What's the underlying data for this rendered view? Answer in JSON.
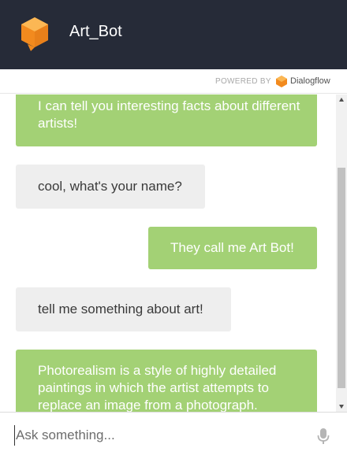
{
  "header": {
    "title": "Art_Bot",
    "logo_color": "#f28a1e",
    "background": "#262b38"
  },
  "powered_by": {
    "label": "POWERED BY",
    "brand": "Dialogflow"
  },
  "messages": [
    {
      "sender": "bot",
      "text": "I can tell you interesting facts about different artists!"
    },
    {
      "sender": "user",
      "text": "cool, what's your name?"
    },
    {
      "sender": "bot",
      "text": "They call me Art Bot!"
    },
    {
      "sender": "user",
      "text": "tell me something about art!"
    },
    {
      "sender": "bot",
      "text": "Photorealism is a style of highly detailed paintings in which the artist attempts to replace an image from a photograph."
    }
  ],
  "colors": {
    "bot_bubble": "#a3d175",
    "user_bubble": "#eeeeee"
  },
  "input": {
    "placeholder": "Ask something...",
    "value": ""
  },
  "icons": {
    "mic": "microphone-icon",
    "logo": "dialogflow-cube-icon"
  }
}
